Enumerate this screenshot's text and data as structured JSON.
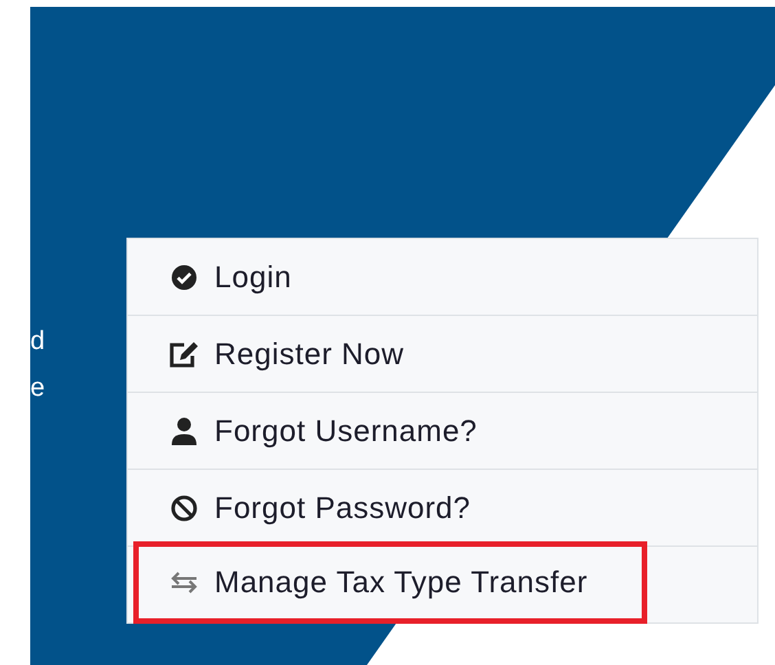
{
  "side_text": [
    "d",
    "e"
  ],
  "menu": [
    {
      "label": "Login",
      "highlighted": false
    },
    {
      "label": "Register Now",
      "highlighted": false
    },
    {
      "label": "Forgot Username?",
      "highlighted": false
    },
    {
      "label": "Forgot Password?",
      "highlighted": false
    },
    {
      "label": "Manage Tax Type Transfer",
      "highlighted": true
    }
  ]
}
